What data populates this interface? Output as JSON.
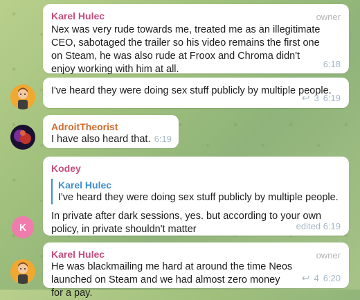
{
  "messages": [
    {
      "sender": "Karel Hulec",
      "sender_color": "#c44d7f",
      "role": "owner",
      "text": "Nex was very rude towards me, treated me as an illegitimate CEO, sabotaged the trailer so his video remains the first one on Steam, he was also rude at Froox and Chroma didn't enjoy working with him at all.",
      "time": "6:18"
    },
    {
      "text": "I've heard they were doing sex stuff publicly by multiple people.",
      "replies": "3",
      "time": "6:19"
    },
    {
      "sender": "AdroitTheorist",
      "sender_color": "#d36b2c",
      "text": "I have also heard that.",
      "time": "6:19"
    },
    {
      "sender": "Kodey",
      "sender_color": "#c44d7f",
      "avatar_letter": "K",
      "avatar_color": "#f07cae",
      "quote": {
        "sender": "Karel Hulec",
        "text": "I've heard they were doing sex stuff publicly by multiple people."
      },
      "text": "In private after dark sessions, yes. but according to your own policy, in private shouldn't matter",
      "time": "edited 6:19"
    },
    {
      "sender": "Karel Hulec",
      "sender_color": "#c44d7f",
      "role": "owner",
      "text": "He was blackmailing me hard at around the time Neos launched on Steam and we had almost zero money for a pay.",
      "replies": "4",
      "time": "6:20"
    }
  ]
}
